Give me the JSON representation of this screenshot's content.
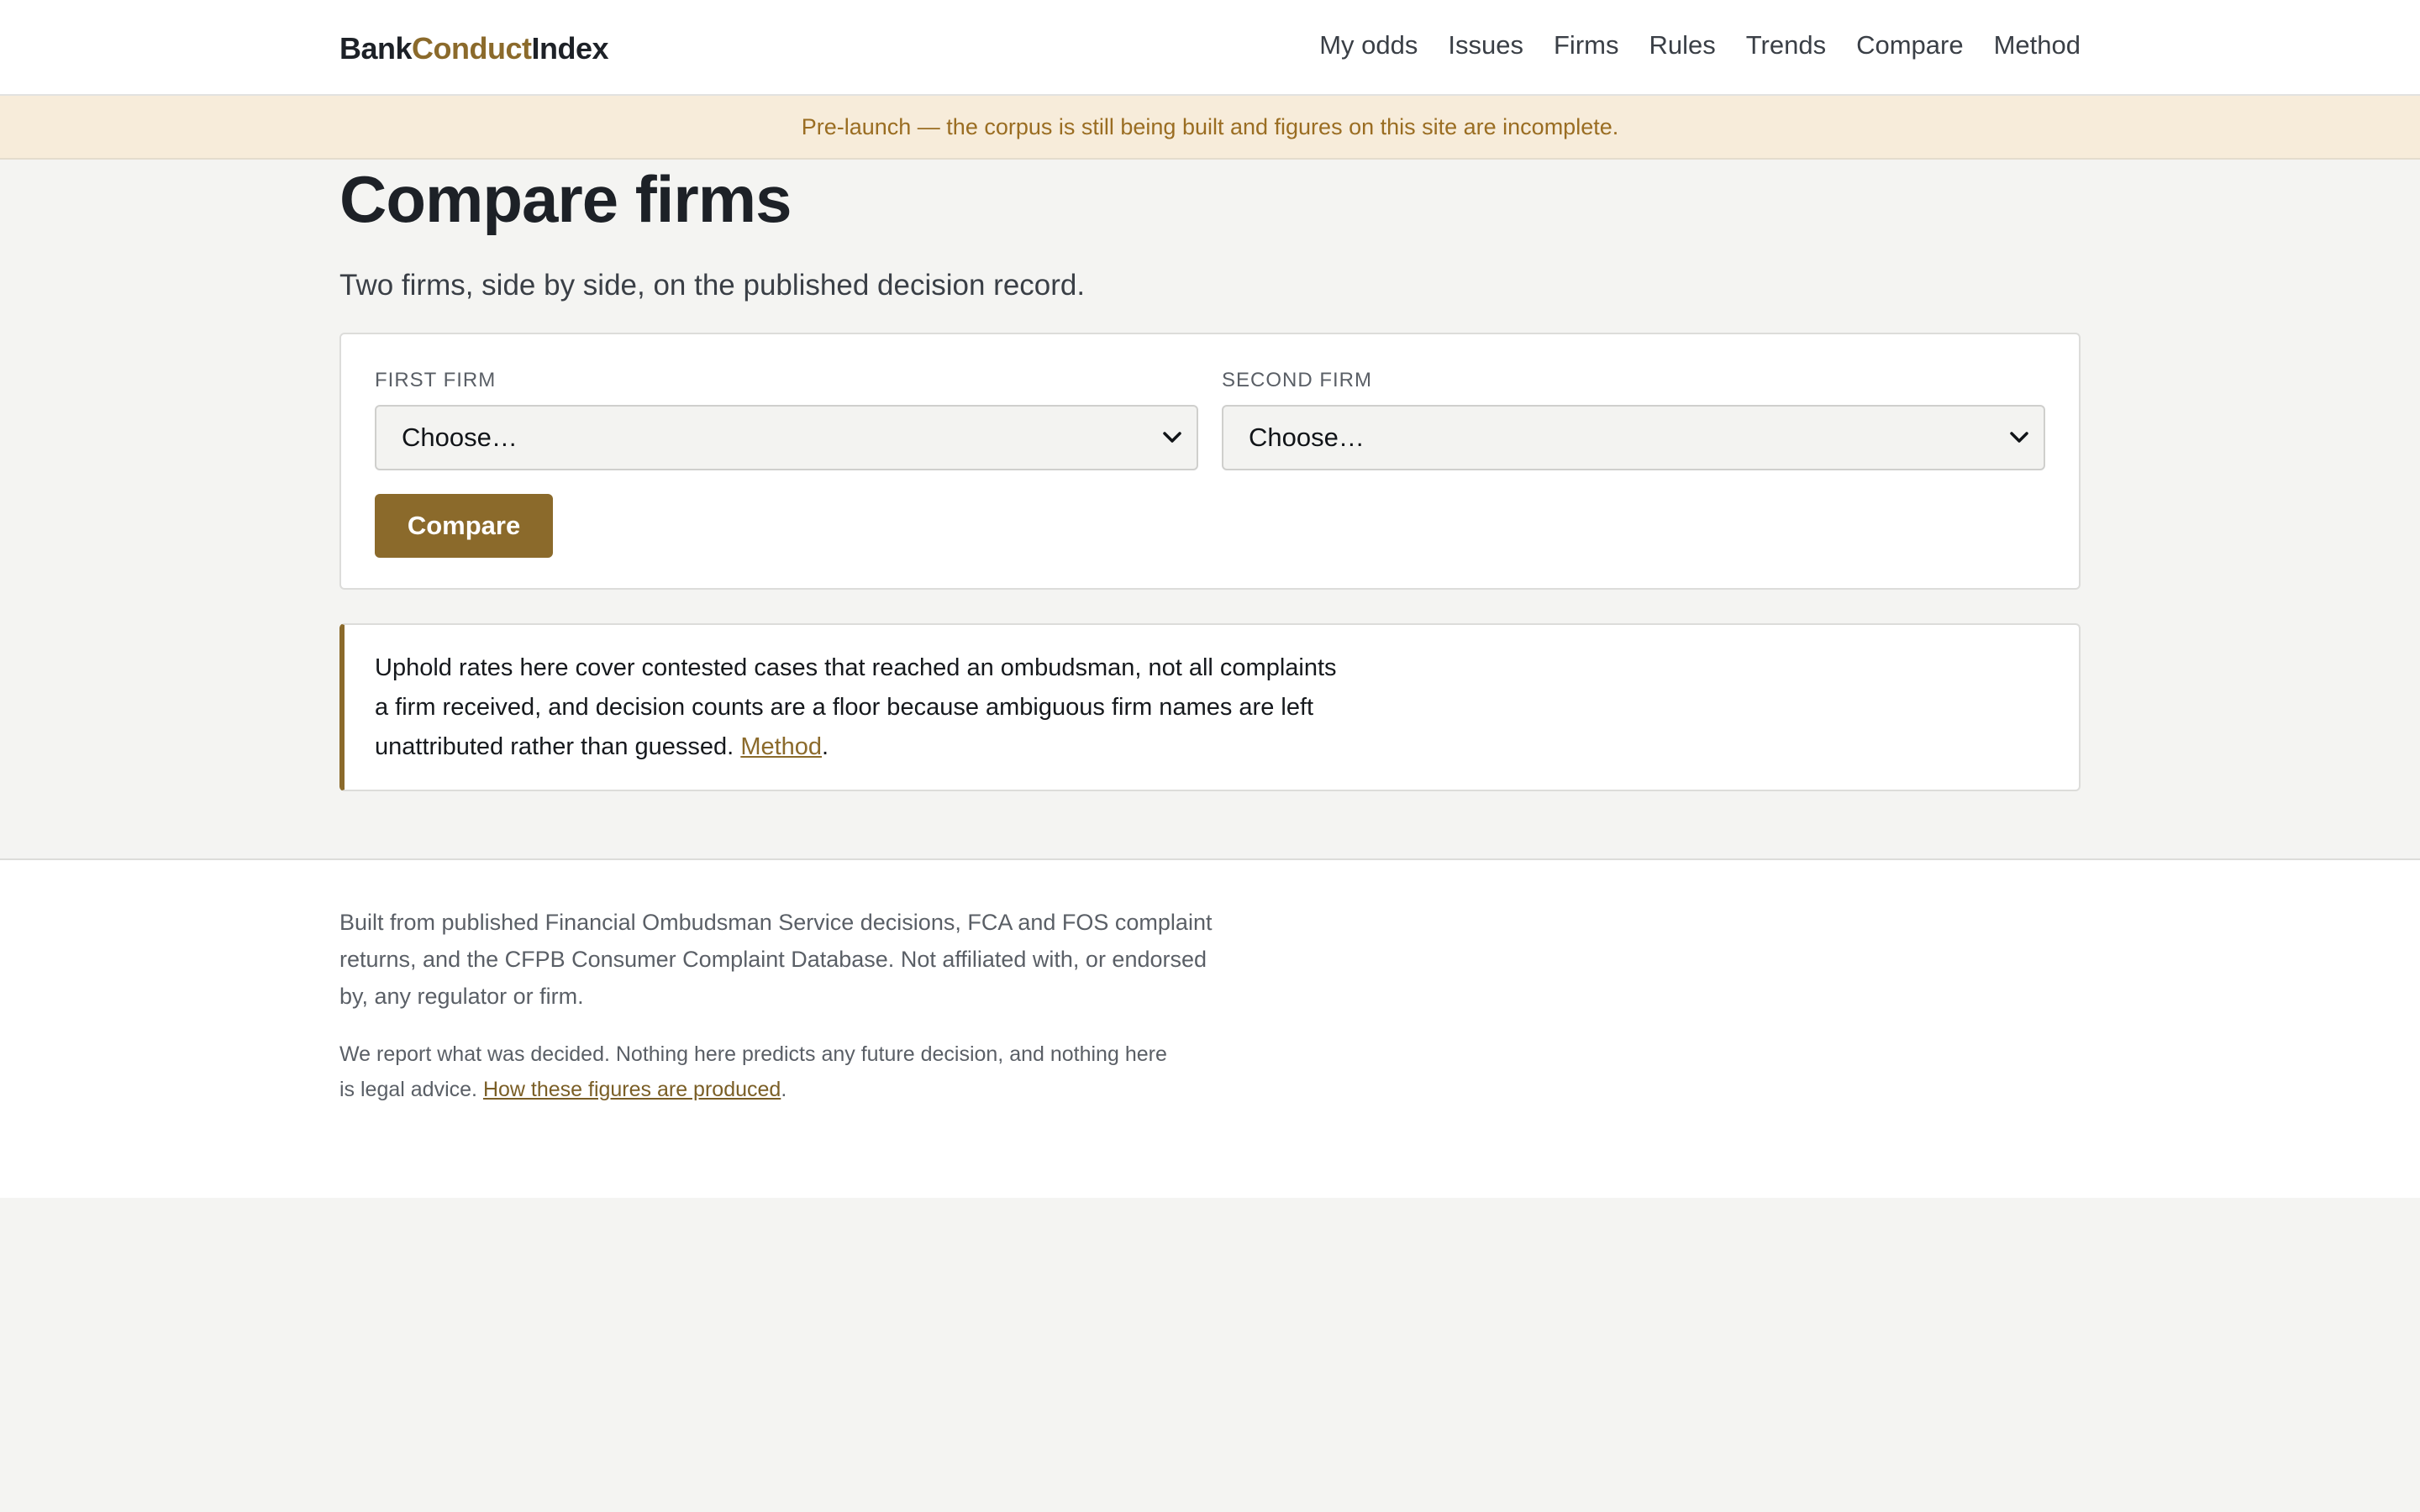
{
  "header": {
    "logo": {
      "part1": "Bank",
      "part2": "Conduct",
      "part3": "Index"
    },
    "nav": [
      "My odds",
      "Issues",
      "Firms",
      "Rules",
      "Trends",
      "Compare",
      "Method"
    ]
  },
  "banner": {
    "text": "Pre-launch — the corpus is still being built and figures on this site are incomplete."
  },
  "main": {
    "title": "Compare firms",
    "subtitle": "Two firms, side by side, on the published decision record.",
    "form": {
      "first_label": "FIRST FIRM",
      "first_value": "Choose…",
      "second_label": "SECOND FIRM",
      "second_value": "Choose…",
      "submit_label": "Compare"
    },
    "note": {
      "text": "Uphold rates here cover contested cases that reached an ombudsman, not all complaints a firm received, and decision counts are a floor because ambiguous firm names are left unattributed rather than guessed. ",
      "link": "Method",
      "end": "."
    }
  },
  "footer": {
    "para1": "Built from published Financial Ombudsman Service decisions, FCA and FOS complaint returns, and the CFPB Consumer Complaint Database. Not affiliated with, or endorsed by, any regulator or firm.",
    "para2_text": "We report what was decided. Nothing here predicts any future decision, and nothing here is legal advice. ",
    "para2_link": "How these figures are produced",
    "para2_end": "."
  },
  "colors": {
    "accent": "#8b6a2b",
    "banner_bg": "#f7ecda",
    "banner_text": "#9a6d22",
    "page_bg": "#f4f4f2"
  },
  "icons": {
    "select": "chevron-down-icon"
  }
}
